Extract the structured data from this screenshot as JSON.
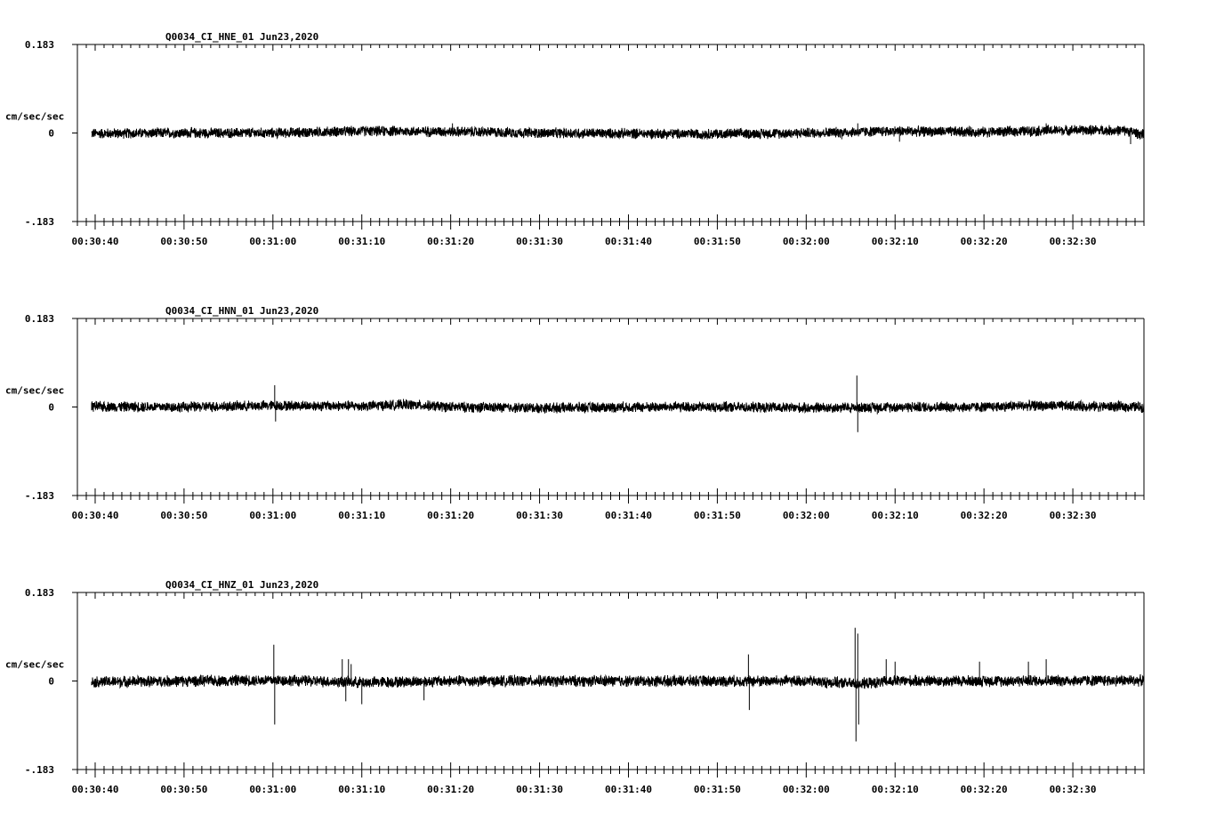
{
  "chart_data": [
    {
      "type": "line",
      "title": "Q0034_CI_HNE_01  Jun23,2020",
      "ylabel": "cm/sec/sec",
      "ylim": [
        -0.183,
        0.183
      ],
      "y_ticks": [
        "0.183",
        "0",
        "-.183"
      ],
      "x_ticks": [
        "00:30:40",
        "00:30:50",
        "00:31:00",
        "00:31:10",
        "00:31:20",
        "00:31:30",
        "00:31:40",
        "00:31:50",
        "00:32:00",
        "00:32:10",
        "00:32:20",
        "00:32:30"
      ],
      "xlim_seconds": [
        38,
        158
      ],
      "series": [
        {
          "noise_amplitude": 0.011,
          "wander": [
            [
              40,
              -0.001
            ],
            [
              50,
              0.0
            ],
            [
              60,
              0.0
            ],
            [
              70,
              0.004
            ],
            [
              80,
              0.003
            ],
            [
              90,
              0.0
            ],
            [
              100,
              -0.001
            ],
            [
              110,
              -0.002
            ],
            [
              120,
              0.0
            ],
            [
              130,
              0.004
            ],
            [
              140,
              0.002
            ],
            [
              150,
              0.006
            ],
            [
              156,
              0.005
            ],
            [
              158,
              -0.004
            ]
          ],
          "spikes": [
            [
              80.2,
              0.02
            ],
            [
              124,
              -0.013
            ],
            [
              125.8,
              0.02
            ],
            [
              130.5,
              -0.018
            ],
            [
              147,
              0.02
            ],
            [
              156.5,
              -0.023
            ]
          ]
        }
      ]
    },
    {
      "type": "line",
      "title": "Q0034_CI_HNN_01  Jun23,2020",
      "ylabel": "cm/sec/sec",
      "ylim": [
        -0.183,
        0.183
      ],
      "y_ticks": [
        "0.183",
        "0",
        "-.183"
      ],
      "x_ticks": [
        "00:30:40",
        "00:30:50",
        "00:31:00",
        "00:31:10",
        "00:31:20",
        "00:31:30",
        "00:31:40",
        "00:31:50",
        "00:32:00",
        "00:32:10",
        "00:32:20",
        "00:32:30"
      ],
      "xlim_seconds": [
        38,
        158
      ],
      "series": [
        {
          "noise_amplitude": 0.011,
          "wander": [
            [
              40,
              0.001
            ],
            [
              50,
              0.0
            ],
            [
              60,
              0.003
            ],
            [
              70,
              0.002
            ],
            [
              75,
              0.005
            ],
            [
              80,
              0.0
            ],
            [
              90,
              -0.002
            ],
            [
              100,
              0.0
            ],
            [
              110,
              0.0
            ],
            [
              120,
              -0.002
            ],
            [
              130,
              0.0
            ],
            [
              140,
              0.0
            ],
            [
              145,
              0.003
            ],
            [
              158,
              0.0
            ]
          ],
          "spikes": [
            [
              60.2,
              0.045
            ],
            [
              60.3,
              -0.03
            ],
            [
              125.7,
              0.065
            ],
            [
              125.8,
              -0.052
            ],
            [
              128,
              -0.015
            ]
          ]
        }
      ]
    },
    {
      "type": "line",
      "title": "Q0034_CI_HNZ_01  Jun23,2020",
      "ylabel": "cm/sec/sec",
      "ylim": [
        -0.183,
        0.183
      ],
      "y_ticks": [
        "0.183",
        "0",
        "-.183"
      ],
      "x_ticks": [
        "00:30:40",
        "00:30:50",
        "00:31:00",
        "00:31:10",
        "00:31:20",
        "00:31:30",
        "00:31:40",
        "00:31:50",
        "00:32:00",
        "00:32:10",
        "00:32:20",
        "00:32:30"
      ],
      "xlim_seconds": [
        38,
        158
      ],
      "series": [
        {
          "noise_amplitude": 0.012,
          "wander": [
            [
              40,
              -0.002
            ],
            [
              50,
              0.0
            ],
            [
              60,
              0.002
            ],
            [
              70,
              -0.003
            ],
            [
              80,
              0.0
            ],
            [
              90,
              0.0
            ],
            [
              100,
              0.0
            ],
            [
              110,
              0.0
            ],
            [
              120,
              0.0
            ],
            [
              126,
              -0.006
            ],
            [
              130,
              0.0
            ],
            [
              140,
              0.0
            ],
            [
              150,
              0.001
            ],
            [
              158,
              0.001
            ]
          ],
          "spikes": [
            [
              60.1,
              0.075
            ],
            [
              60.2,
              -0.09
            ],
            [
              67.8,
              0.045
            ],
            [
              68.2,
              -0.042
            ],
            [
              68.5,
              0.045
            ],
            [
              68.8,
              0.035
            ],
            [
              70,
              -0.048
            ],
            [
              77,
              -0.04
            ],
            [
              113.5,
              0.055
            ],
            [
              113.6,
              -0.06
            ],
            [
              125.5,
              0.11
            ],
            [
              125.6,
              -0.125
            ],
            [
              125.8,
              0.098
            ],
            [
              125.9,
              -0.09
            ],
            [
              129,
              0.045
            ],
            [
              130,
              0.04
            ],
            [
              139.5,
              0.04
            ],
            [
              145,
              0.04
            ],
            [
              147,
              0.045
            ]
          ]
        }
      ]
    }
  ]
}
